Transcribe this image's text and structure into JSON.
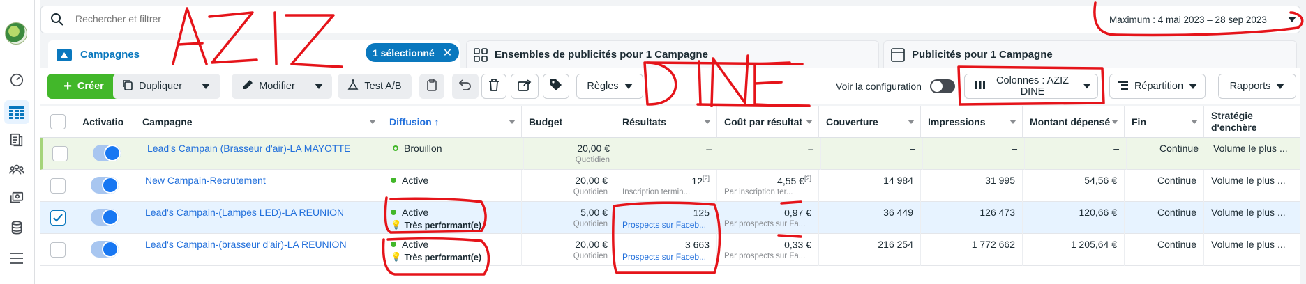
{
  "search": {
    "placeholder": "Rechercher et filtrer"
  },
  "date_range": {
    "label": "Maximum : 4 mai 2023 – 28 sep 2023"
  },
  "tabs": [
    {
      "label": "Campagnes"
    },
    {
      "label": "Ensembles de publicités pour 1 Campagne"
    },
    {
      "label": "Publicités pour 1 Campagne"
    }
  ],
  "selection": {
    "label": "1 sélectionné"
  },
  "toolbar": {
    "create": "Créer",
    "duplicate": "Dupliquer",
    "edit": "Modifier",
    "abtest": "Test A/B",
    "rules": "Règles",
    "view_config": "Voir la configuration",
    "columns": "Colonnes : AZIZ DINE",
    "breakdown": "Répartition",
    "reports": "Rapports"
  },
  "columns": {
    "activation": "Activatio",
    "campaign": "Campagne",
    "delivery": "Diffusion ↑",
    "budget": "Budget",
    "results": "Résultats",
    "cost_per_result": "Coût par résultat",
    "reach": "Couverture",
    "impressions": "Impressions",
    "amount_spent": "Montant dépensé",
    "end": "Fin",
    "bid_strategy_1": "Stratégie",
    "bid_strategy_2": "d'enchère"
  },
  "rows": [
    {
      "name": "Lead's Campain (Brasseur d'air)-LA MAYOTTE",
      "delivery": "Brouillon",
      "perf": "",
      "budget": "20,00 €",
      "budget_sub": "Quotidien",
      "results": "–",
      "results_sub": "",
      "results_note": "",
      "cost": "–",
      "cost_sub": "",
      "cost_note": "",
      "reach": "–",
      "impressions": "–",
      "spent": "–",
      "end": "Continue",
      "bid": "Volume le plus ..."
    },
    {
      "name": "New Campain-Recrutement",
      "delivery": "Active",
      "perf": "",
      "budget": "20,00 €",
      "budget_sub": "Quotidien",
      "results": "12",
      "results_sub": "Inscription termin...",
      "results_note": "[2]",
      "cost": "4,55 €",
      "cost_sub": "Par inscription ter...",
      "cost_note": "[2]",
      "reach": "14 984",
      "impressions": "31 995",
      "spent": "54,56 €",
      "end": "Continue",
      "bid": "Volume le plus ..."
    },
    {
      "name": "Lead's Campain-(Lampes LED)-LA REUNION",
      "delivery": "Active",
      "perf": "Très performant(e)",
      "budget": "5,00 €",
      "budget_sub": "Quotidien",
      "results": "125",
      "results_sub": "Prospects sur Faceb...",
      "results_note": "",
      "cost": "0,97 €",
      "cost_sub": "Par prospects sur Fa...",
      "cost_note": "",
      "reach": "36 449",
      "impressions": "126 473",
      "spent": "120,66 €",
      "end": "Continue",
      "bid": "Volume le plus ..."
    },
    {
      "name": "Lead's Campain-(brasseur d'air)-LA REUNION",
      "delivery": "Active",
      "perf": "Très performant(e)",
      "budget": "20,00 €",
      "budget_sub": "Quotidien",
      "results": "3 663",
      "results_sub": "Prospects sur Faceb...",
      "results_note": "",
      "cost": "0,33 €",
      "cost_sub": "Par prospects sur Fa...",
      "cost_note": "",
      "reach": "216 254",
      "impressions": "1 772 662",
      "spent": "1 205,64 €",
      "end": "Continue",
      "bid": "Volume le plus ..."
    }
  ],
  "colors": {
    "accent": "#0a78be",
    "create_green": "#42b72a",
    "link_blue": "#216fdb",
    "annotation_red": "#e5141a"
  }
}
